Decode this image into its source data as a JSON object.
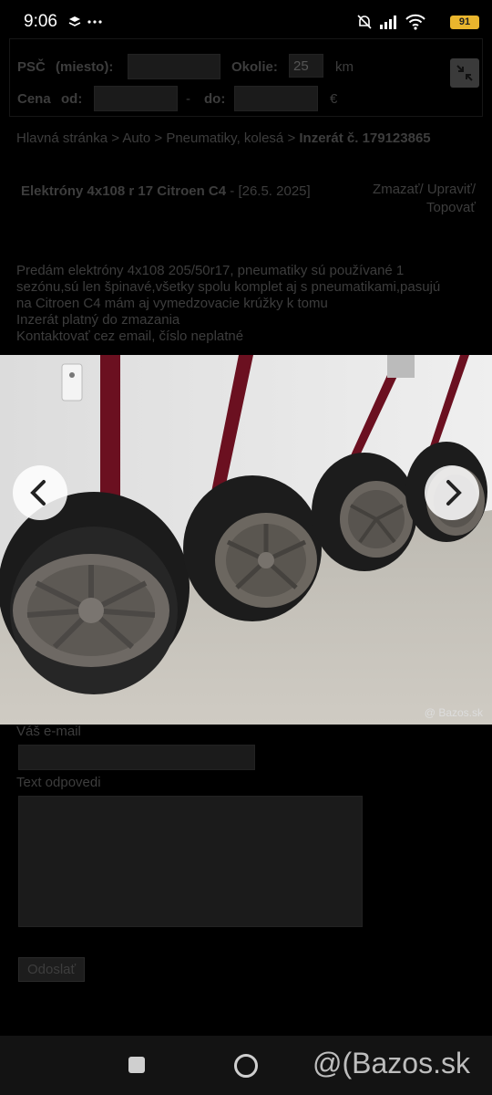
{
  "status_bar": {
    "time": "9:06",
    "battery": "91"
  },
  "search": {
    "psc_label": "PSČ",
    "psc_sub": "(miesto):",
    "okolie_label": "Okolie:",
    "okolie_value": "25",
    "okolie_unit": "km",
    "cena_label": "Cena",
    "cena_od": "od:",
    "cena_dash": "-",
    "cena_do": "do:",
    "currency": "€"
  },
  "breadcrumb": {
    "home": "Hlavná stránka",
    "sep": ">",
    "auto": "Auto",
    "category": "Pneumatiky, kolesá",
    "ad": "Inzerát č. 179123865"
  },
  "ad": {
    "title": "Elektróny 4x108 r 17 Citroen C4",
    "date": "- [26.5. 2025]",
    "actions": "Zmazať/ Upraviť/ Topovať",
    "description_lines": [
      "Predám elektróny 4x108 205/50r17, pneumatiky sú používané 1",
      "sezónu,sú len špinavé,všetky spolu komplet aj s pneumatikami,pasujú",
      "na Citroen C4 mám aj vymedzovacie krúžky k tomu",
      "Inzerát platný do zmazania",
      "Kontaktovať cez email, číslo neplatné"
    ]
  },
  "photo": {
    "watermark": "@ Bazos.sk"
  },
  "form": {
    "email_label": "Váš e-mail",
    "text_label": "Text odpovedi",
    "send_label": "Odoslať"
  },
  "nav": {
    "brand": "@(Bazos.sk"
  },
  "colors": {
    "battery": "#e9b52d",
    "background": "#000000"
  }
}
